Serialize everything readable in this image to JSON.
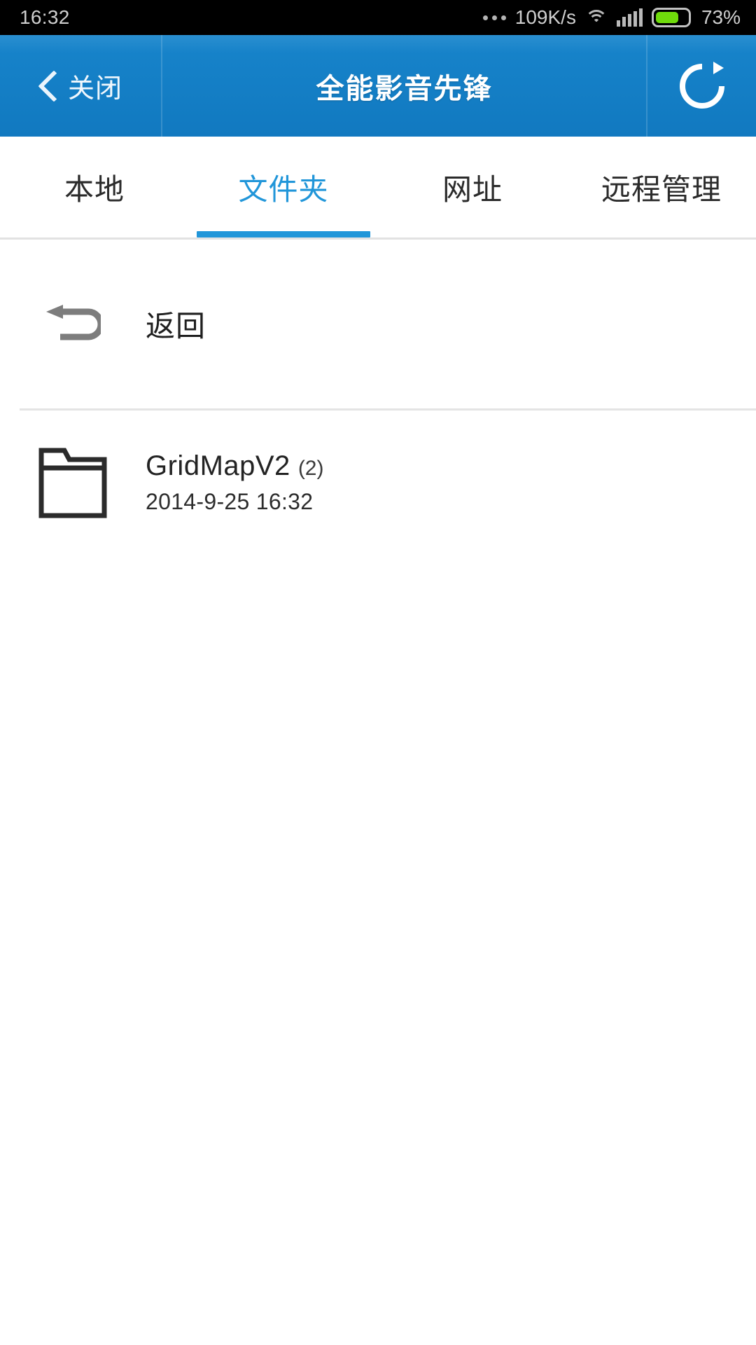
{
  "statusbar": {
    "time": "16:32",
    "overflow_icon": "more-dots-icon",
    "network_speed": "109K/s",
    "wifi_icon": "wifi-icon",
    "signal_icon": "cellular-signal-icon",
    "battery_icon": "battery-icon",
    "battery_percent": "73%",
    "battery_level": 73,
    "battery_color": "#6fdc0b"
  },
  "header": {
    "back_icon": "chevron-left-icon",
    "close_label": "关闭",
    "title": "全能影音先锋",
    "refresh_icon": "refresh-icon",
    "background_color": "#1580c8"
  },
  "tabs": {
    "active_index": 1,
    "accent_color": "#2196d9",
    "items": [
      {
        "label": "本地"
      },
      {
        "label": "文件夹"
      },
      {
        "label": "网址"
      },
      {
        "label": "远程管理"
      }
    ]
  },
  "list": {
    "back_row": {
      "icon": "undo-return-arrow-icon",
      "label": "返回"
    },
    "items": [
      {
        "icon": "folder-icon",
        "name": "GridMapV2",
        "count": "(2)",
        "date": "2014-9-25 16:32"
      }
    ]
  }
}
